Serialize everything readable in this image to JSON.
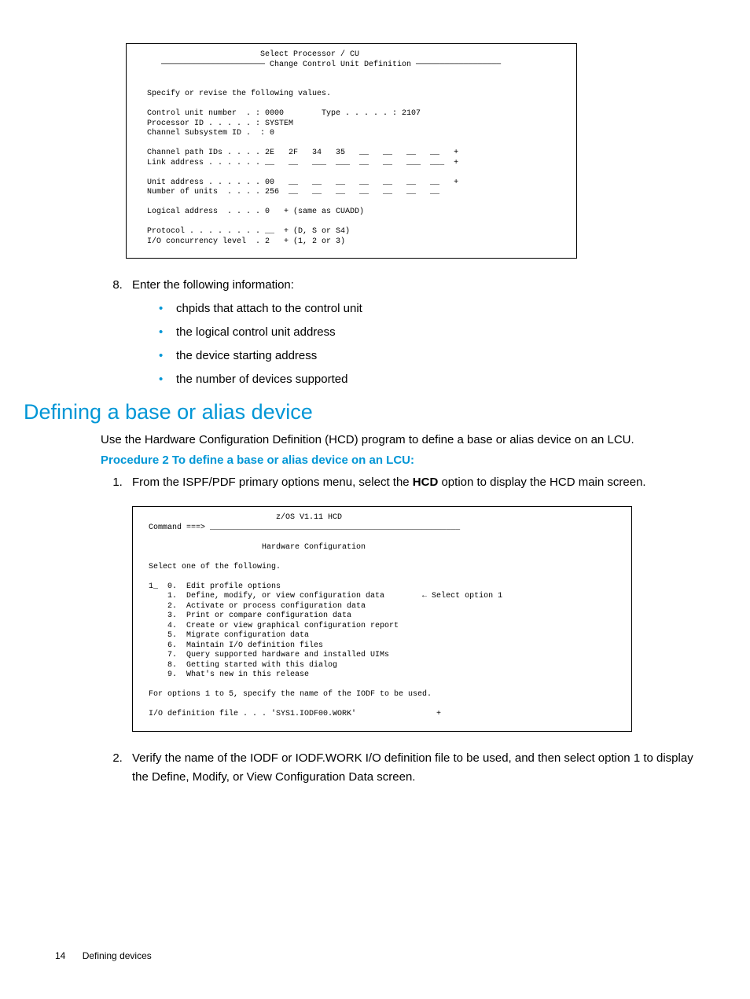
{
  "terminal1": "                          Select Processor / CU\n     ────────────────────── Change Control Unit Definition ──────────────────\n\n\n  Specify or revise the following values.\n\n  Control unit number  . : 0000        Type . . . . . : 2107\n  Processor ID . . . . . : SYSTEM\n  Channel Subsystem ID .  : 0\n\n  Channel path IDs . . . . 2E   2F   34   35   __   __   __   __   +\n  Link address . . . . . . __   __   ___  ___  __   __   ___  ___  +\n\n  Unit address . . . . . . 00   __   __   __   __   __   __   __   +\n  Number of units  . . . . 256  __   __   __   __   __   __   __\n\n  Logical address  . . . . 0   + (same as CUADD)\n\n  Protocol . . . . . . . . __  + (D, S or S4)\n  I/O concurrency level  . 2   + (1, 2 or 3)\n",
  "terminal2": "                            z/OS V1.11 HCD\n Command ===> _____________________________________________________\n\n                         Hardware Configuration\n\n Select one of the following.\n\n 1_  0.  Edit profile options\n     1.  Define, modify, or view configuration data        ← Select option 1\n     2.  Activate or process configuration data\n     3.  Print or compare configuration data\n     4.  Create or view graphical configuration report\n     5.  Migrate configuration data\n     6.  Maintain I/O definition files\n     7.  Query supported hardware and installed UIMs\n     8.  Getting started with this dialog\n     9.  What's new in this release\n\n For options 1 to 5, specify the name of the IODF to be used.\n\n I/O definition file . . . 'SYS1.IODF00.WORK'                 +",
  "step8": {
    "lead": "Enter the following information:",
    "items": [
      "chpids that attach to the control unit",
      "the logical control unit address",
      "the device starting address",
      "the number of devices supported"
    ]
  },
  "section_title": "Defining a base or alias device",
  "section_intro": "Use the Hardware Configuration Definition (HCD) program to define a base or alias device on an LCU.",
  "procedure_title": "Procedure 2 To define a base or alias device on an LCU:",
  "proc_steps": {
    "s1_pre": "From the ISPF/PDF primary options menu, select the ",
    "s1_bold": "HCD",
    "s1_post": " option to display the HCD main screen.",
    "s2": "Verify the name of the IODF or IODF.WORK I/O definition file to be used, and then select option 1 to display the Define, Modify, or View Configuration Data screen."
  },
  "footer": {
    "page": "14",
    "label": "Defining devices"
  }
}
